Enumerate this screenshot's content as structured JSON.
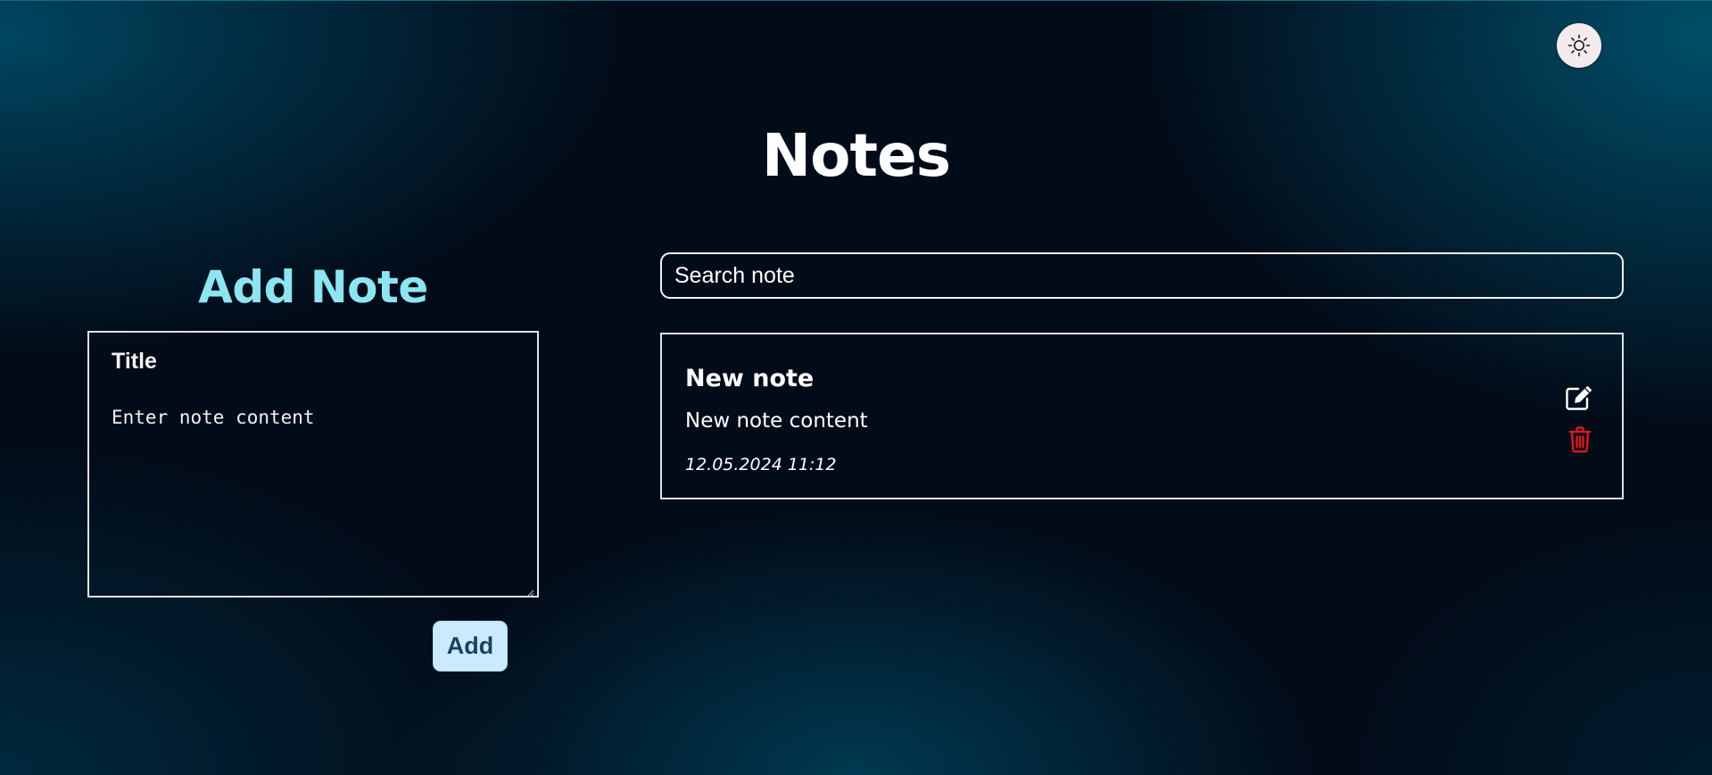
{
  "header": {
    "title": "Notes",
    "theme_toggle_icon": "sun-icon"
  },
  "add_note": {
    "heading": "Add Note",
    "title_placeholder": "Title",
    "title_value": "",
    "content_placeholder": "Enter note content",
    "content_value": "",
    "add_label": "Add"
  },
  "search": {
    "placeholder": "Search note",
    "value": ""
  },
  "notes": [
    {
      "title": "New note",
      "content": "New note content",
      "date": "12.05.2024 11:12",
      "edit_icon": "edit-icon",
      "delete_icon": "trash-icon"
    }
  ],
  "colors": {
    "background": "#020b18",
    "accent_heading": "#8ce6f1",
    "button_bg": "#cceaff",
    "button_text": "#19435f",
    "delete_red": "#e0161c",
    "border": "#dbe4ea"
  }
}
